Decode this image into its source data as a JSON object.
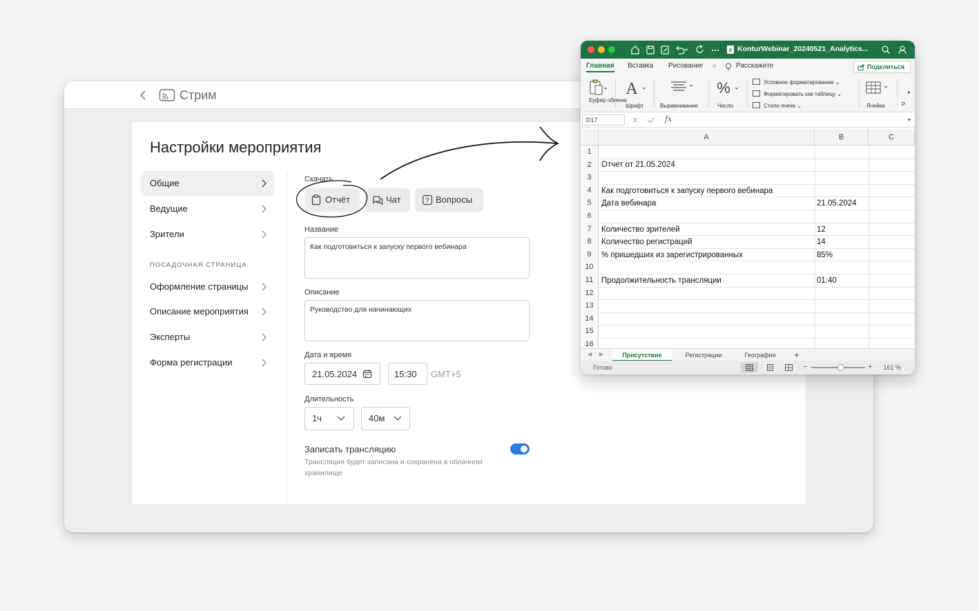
{
  "app": {
    "title": "Стрим"
  },
  "settings": {
    "title": "Настройки мероприятия",
    "nav": [
      {
        "label": "Общие"
      },
      {
        "label": "Ведущие"
      },
      {
        "label": "Зрители"
      }
    ],
    "section_label": "ПОСАДОЧНАЯ СТРАНИЦА",
    "nav2": [
      {
        "label": "Оформление страницы"
      },
      {
        "label": "Описание мероприятия"
      },
      {
        "label": "Эксперты"
      },
      {
        "label": "Форма регистрации"
      }
    ],
    "download": {
      "label": "Скачать",
      "report": "Отчёт",
      "chat": "Чат",
      "questions": "Вопросы"
    },
    "name": {
      "label": "Название",
      "value": "Как подготовиться к запуску первого вебинара"
    },
    "description": {
      "label": "Описание",
      "value": "Руководство для начинающих"
    },
    "datetime": {
      "label": "Дата и время",
      "date": "21.05.2024",
      "time": "15:30",
      "timezone": "GMT+5"
    },
    "duration": {
      "label": "Длительность",
      "hours": "1ч",
      "minutes": "40м"
    },
    "record": {
      "title": "Записать трансляцию",
      "description": "Трансляция будет записана и сохранена в облачном хранилище",
      "enabled": true
    }
  },
  "excel": {
    "file_name": "KonturWebinar_20240521_Analytics...",
    "tabs": [
      "Главная",
      "Вставка",
      "Рисование",
      "Расскажите"
    ],
    "share": "Поделиться",
    "ribbon": {
      "clipboard": "Буфер обмена",
      "font": "Шрифт",
      "alignment": "Выравнивание",
      "number": "Число",
      "conditional": "Условное форматирование",
      "format_table": "Форматировать как таблицу",
      "cell_styles": "Стили ячеек",
      "cells": "Ячейки",
      "cut_label": "Р"
    },
    "name_box": "D17",
    "fx": "fx",
    "columns": [
      "A",
      "B",
      "C"
    ],
    "row_numbers": [
      "1",
      "2",
      "3",
      "4",
      "5",
      "6",
      "7",
      "8",
      "9",
      "10",
      "11",
      "12",
      "13",
      "14",
      "15",
      "16"
    ],
    "cells": {
      "a2": "Отчет от 21.05.2024",
      "a4": "Как подготовиться к запуску первого вебинара",
      "a5": "Дата вебинара",
      "b5": "21.05.2024",
      "a7": "Количество зрителей",
      "b7": "12",
      "a8": "Количество регистраций",
      "b8": "14",
      "a9": "% пришедших из зарегистрированных",
      "b9": "85%",
      "a11": "Продолжительность трансляции",
      "b11": "01:40"
    },
    "sheets": [
      "Присутствие",
      "Регистрации",
      "География"
    ],
    "add_sheet": "+",
    "status": "Готово",
    "zoom": "161 %"
  },
  "colors": {
    "excel_green": "#1f7244",
    "toggle_blue": "#2f7ae0"
  }
}
